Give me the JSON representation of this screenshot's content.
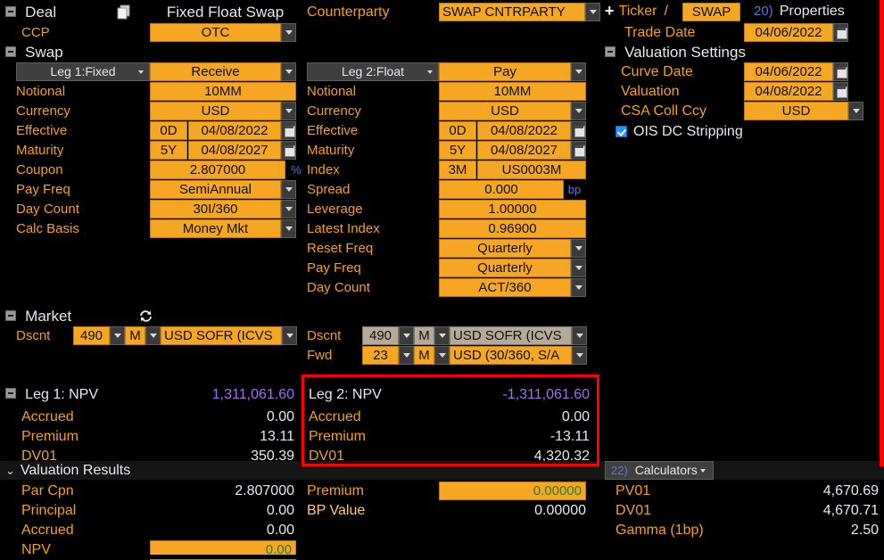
{
  "deal": {
    "section_label": "Deal",
    "copy_icon": "copy-icon",
    "title": "Fixed Float Swap",
    "ccp_label": "CCP",
    "ccp_value": "OTC",
    "counterparty_label": "Counterparty",
    "counterparty_value": "SWAP CNTRPARTY",
    "ticker_label": "Ticker",
    "ticker_sep": "/",
    "ticker_value": "SWAP",
    "properties_num": "20)",
    "properties_label": "Properties",
    "trade_date_label": "Trade Date",
    "trade_date_value": "04/06/2022"
  },
  "swap": {
    "section_label": "Swap"
  },
  "valuation_settings": {
    "section_label": "Valuation Settings",
    "rows": [
      {
        "label": "Curve Date",
        "value": "04/06/2022",
        "type": "date"
      },
      {
        "label": "Valuation",
        "value": "04/08/2022",
        "type": "date"
      },
      {
        "label": "CSA Coll Ccy",
        "value": "USD",
        "type": "select"
      }
    ],
    "ois_label": "OIS DC Stripping",
    "ois_checked": true
  },
  "leg1": {
    "header": "Leg 1:Fixed",
    "direction": "Receive",
    "rows": [
      {
        "label": "Notional",
        "value": "10MM"
      },
      {
        "label": "Currency",
        "value": "USD"
      },
      {
        "label": "Effective",
        "tenor": "0D",
        "value": "04/08/2022"
      },
      {
        "label": "Maturity",
        "tenor": "5Y",
        "value": "04/08/2027"
      },
      {
        "label": "Coupon",
        "value": "2.807000",
        "suffix": "%"
      },
      {
        "label": "Pay Freq",
        "value": "SemiAnnual"
      },
      {
        "label": "Day Count",
        "value": "30I/360"
      },
      {
        "label": "Calc Basis",
        "value": "Money Mkt"
      }
    ]
  },
  "leg2": {
    "header": "Leg 2:Float",
    "direction": "Pay",
    "rows": [
      {
        "label": "Notional",
        "value": "10MM"
      },
      {
        "label": "Currency",
        "value": "USD"
      },
      {
        "label": "Effective",
        "tenor": "0D",
        "value": "04/08/2022"
      },
      {
        "label": "Maturity",
        "tenor": "5Y",
        "value": "04/08/2027"
      },
      {
        "label": "Index",
        "tenor": "3M",
        "value": "US0003M"
      },
      {
        "label": "Spread",
        "value": "0.000",
        "suffix": "bp"
      },
      {
        "label": "Leverage",
        "value": "1.00000"
      },
      {
        "label": "Latest Index",
        "value": "0.96900"
      },
      {
        "label": "Reset Freq",
        "value": "Quarterly"
      },
      {
        "label": "Pay Freq",
        "value": "Quarterly"
      },
      {
        "label": "Day Count",
        "value": "ACT/360"
      }
    ]
  },
  "market": {
    "section_label": "Market",
    "refresh_icon": "refresh-icon",
    "leg1": [
      {
        "label": "Dscnt",
        "num": "490",
        "unit": "M",
        "curve": "USD SOFR    (ICVS"
      }
    ],
    "leg2": [
      {
        "label": "Dscnt",
        "num": "490",
        "unit": "M",
        "curve": "USD SOFR    (ICVS",
        "disabled": true
      },
      {
        "label": "Fwd",
        "num": "23",
        "unit": "M",
        "curve": "USD (30/360, S/A",
        "disabled": false
      }
    ]
  },
  "leg1_results": {
    "header": "Leg 1: NPV",
    "header_value": "1,311,061.60",
    "rows": [
      {
        "label": "Accrued",
        "value": "0.00"
      },
      {
        "label": "Premium",
        "value": "13.11"
      },
      {
        "label": "DV01",
        "value": "350.39"
      }
    ]
  },
  "leg2_results": {
    "header": "Leg 2: NPV",
    "header_value": "-1,311,061.60",
    "rows": [
      {
        "label": "Accrued",
        "value": "0.00"
      },
      {
        "label": "Premium",
        "value": "-13.11"
      },
      {
        "label": "DV01",
        "value": "4,320.32"
      }
    ]
  },
  "valuation_results": {
    "section_label": "Valuation Results",
    "left_rows": [
      {
        "label": "Par Cpn",
        "value": "2.807000",
        "field": false
      },
      {
        "label": "Principal",
        "value": "0.00",
        "field": false
      },
      {
        "label": "Accrued",
        "value": "0.00",
        "field": false
      },
      {
        "label": "NPV",
        "value": "0.00",
        "field": true
      }
    ],
    "mid_rows": [
      {
        "label": "Premium",
        "value": "0.00000",
        "field": true
      },
      {
        "label": "BP Value",
        "value": "0.00000",
        "field": false
      }
    ]
  },
  "calculators": {
    "num": "22)",
    "label": "Calculators",
    "rows": [
      {
        "label": "PV01",
        "value": "4,670.69"
      },
      {
        "label": "DV01",
        "value": "4,670.71"
      },
      {
        "label": "Gamma (1bp)",
        "value": "2.50"
      }
    ]
  },
  "colors": {
    "amber": "#f5a623",
    "label_orange": "#f5a01e",
    "violet": "#a46ef0",
    "green": "#2f7d2f",
    "blue": "#5a78d8",
    "highlight_red": "#ff0000",
    "panel_dark": "#151515"
  }
}
